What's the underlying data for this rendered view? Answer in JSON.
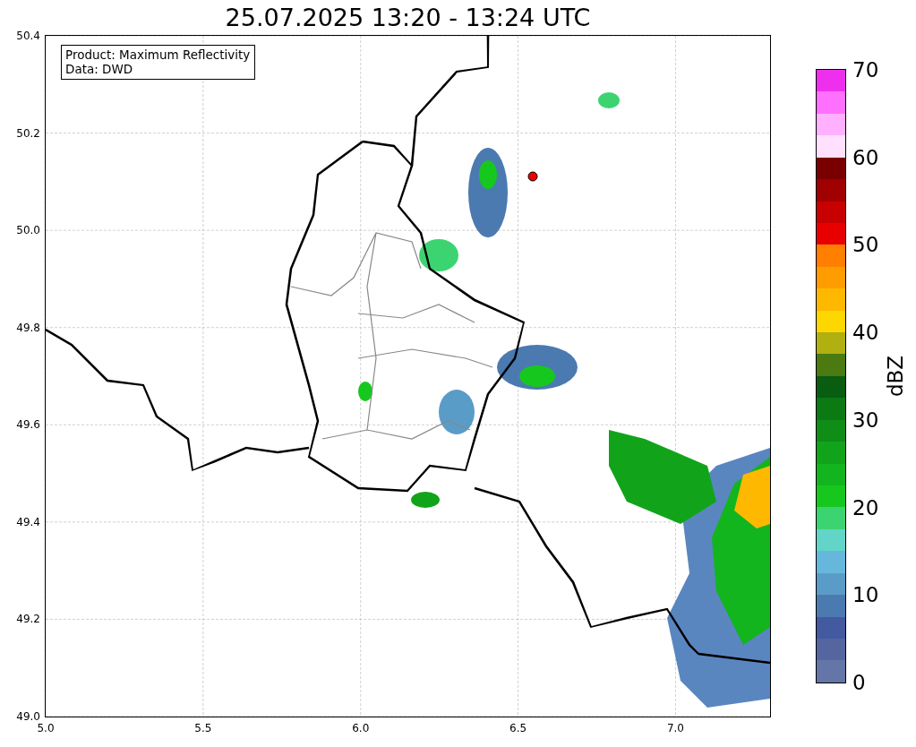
{
  "title": "25.07.2025 13:20 - 13:24 UTC",
  "map": {
    "legend": [
      "Product: Maximum Reflectivity",
      "Data: DWD"
    ],
    "x_ticks": [
      "5.0",
      "5.5",
      "6.0",
      "6.5",
      "7.0"
    ],
    "y_ticks": [
      "50.4",
      "50.2",
      "50.0",
      "49.8",
      "49.6",
      "49.4",
      "49.2",
      "49.0"
    ]
  },
  "colorbar": {
    "label": "dBZ",
    "ticks": [
      "70",
      "60",
      "50",
      "40",
      "30",
      "20",
      "10",
      "0"
    ],
    "bands": [
      {
        "color": "#ee30ee"
      },
      {
        "color": "#ff70ff"
      },
      {
        "color": "#ffb0ff"
      },
      {
        "color": "#ffe0ff"
      },
      {
        "color": "#7a0000"
      },
      {
        "color": "#a00000"
      },
      {
        "color": "#c80000"
      },
      {
        "color": "#e80000"
      },
      {
        "color": "#ff7f00"
      },
      {
        "color": "#ff9c00"
      },
      {
        "color": "#ffb800"
      },
      {
        "color": "#ffd700"
      },
      {
        "color": "#b0b010"
      },
      {
        "color": "#4a7a10"
      },
      {
        "color": "#085d10"
      },
      {
        "color": "#0b7a13"
      },
      {
        "color": "#0f8d17"
      },
      {
        "color": "#11a41a"
      },
      {
        "color": "#12b51d"
      },
      {
        "color": "#16c81e"
      },
      {
        "color": "#3cd471"
      },
      {
        "color": "#62d4c8"
      },
      {
        "color": "#65b8dc"
      },
      {
        "color": "#5a9cc8"
      },
      {
        "color": "#4b7ab0"
      },
      {
        "color": "#4359a0"
      },
      {
        "color": "#5565a0"
      },
      {
        "color": "#6476a8"
      }
    ]
  }
}
